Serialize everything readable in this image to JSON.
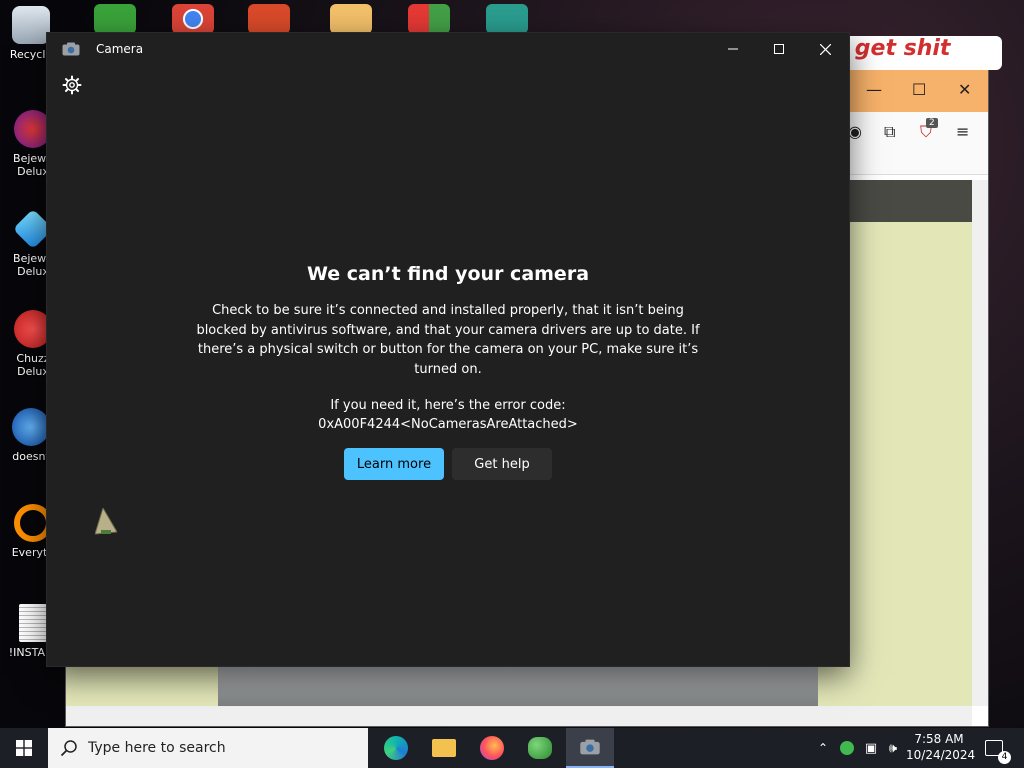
{
  "desktop": {
    "icons": [
      {
        "label": "Recycle"
      },
      {
        "label": "Bejewe Delux"
      },
      {
        "label": "Bejewe Delux"
      },
      {
        "label": "Chuzz Delux"
      },
      {
        "label": "doesnt"
      },
      {
        "label": "Everyth"
      },
      {
        "label": "!INSTALL"
      }
    ]
  },
  "background_window": {
    "scribble_text": "o get shit",
    "badge_count": "2"
  },
  "camera_window": {
    "title": "Camera",
    "error": {
      "heading": "We can’t find your camera",
      "body": "Check to be sure it’s connected and installed properly, that it isn’t being blocked by antivirus software, and that your camera drivers are up to date. If there’s a physical switch or button for the camera on your PC, make sure it’s turned on.",
      "code_label": "If you need it, here’s the error code:",
      "code": "0xA00F4244<NoCamerasAreAttached>"
    },
    "buttons": {
      "learn_more": "Learn more",
      "get_help": "Get help"
    }
  },
  "taskbar": {
    "search_placeholder": "Type here to search",
    "clock_time": "7:58 AM",
    "clock_date": "10/24/2024",
    "notification_count": "4"
  },
  "colors": {
    "accent_button": "#4cc2ff",
    "camera_bg": "#202020",
    "taskbar_bg": "#1c1f26"
  }
}
